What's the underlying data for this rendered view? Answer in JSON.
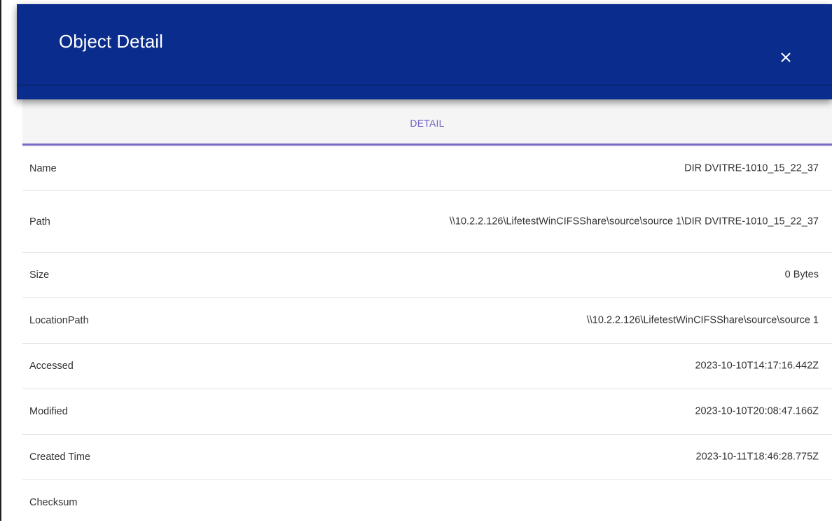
{
  "dialog": {
    "title": "Object Detail",
    "close_glyph": "×",
    "close_icon": "close-icon"
  },
  "tabs": [
    {
      "label": "DETAIL",
      "active": true
    }
  ],
  "colors": {
    "header_bg": "#0a2c8c",
    "tab_active": "#7a68c6",
    "tab_label": "#7060c0",
    "tabbar_bg": "#f5f5f5"
  },
  "details": [
    {
      "label": "Name",
      "value": "DIR DVITRE-1010_15_22_37"
    },
    {
      "label": "Path",
      "value": "\\\\10.2.2.126\\LifetestWinCIFSShare\\source\\source 1\\DIR DVITRE-1010_15_22_37"
    },
    {
      "label": "Size",
      "value": "0 Bytes"
    },
    {
      "label": "LocationPath",
      "value": "\\\\10.2.2.126\\LifetestWinCIFSShare\\source\\source 1"
    },
    {
      "label": "Accessed",
      "value": "2023-10-10T14:17:16.442Z"
    },
    {
      "label": "Modified",
      "value": "2023-10-10T20:08:47.166Z"
    },
    {
      "label": "Created Time",
      "value": "2023-10-11T18:46:28.775Z"
    },
    {
      "label": "Checksum",
      "value": ""
    }
  ]
}
